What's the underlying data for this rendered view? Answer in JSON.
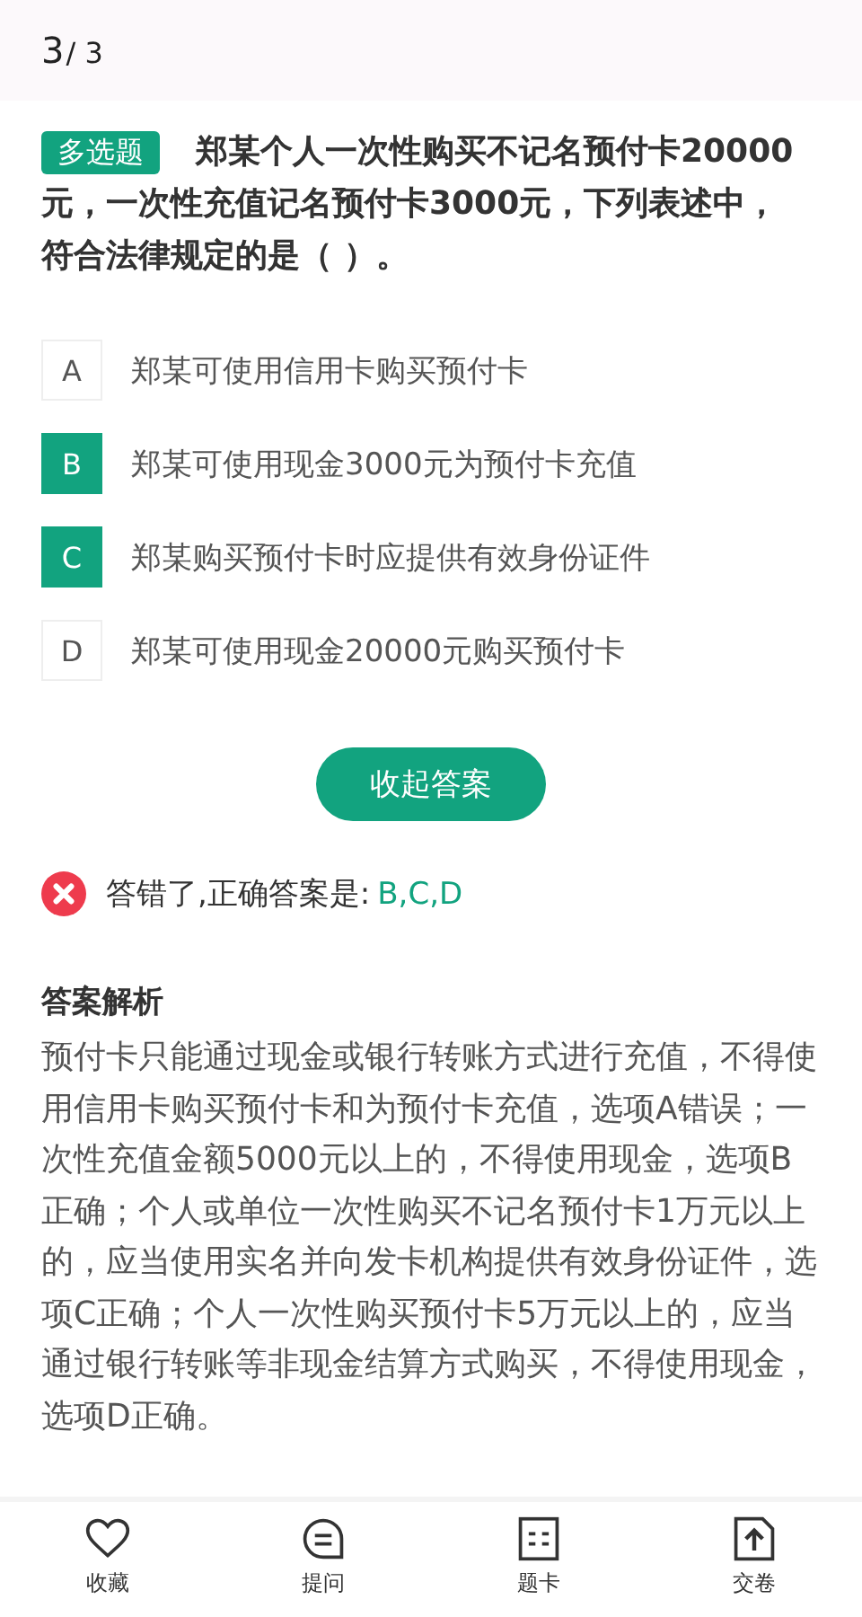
{
  "header": {
    "current": "3",
    "total": "/ 3"
  },
  "question": {
    "type_tag": "多选题",
    "text": "郑某个人一次性购买不记名预付卡20000元，一次性充值记名预付卡3000元，下列表述中，符合法律规定的是（ ）。"
  },
  "options": [
    {
      "letter": "A",
      "text": "郑某可使用信用卡购买预付卡",
      "selected": false
    },
    {
      "letter": "B",
      "text": "郑某可使用现金3000元为预付卡充值",
      "selected": true
    },
    {
      "letter": "C",
      "text": "郑某购买预付卡时应提供有效身份证件",
      "selected": true
    },
    {
      "letter": "D",
      "text": "郑某可使用现金20000元购买预付卡",
      "selected": false
    }
  ],
  "toggle_button": "收起答案",
  "result": {
    "correct": false,
    "message": "答错了,正确答案是:",
    "answer": "B,C,D"
  },
  "explanation": {
    "title": "答案解析",
    "text": "预付卡只能通过现金或银行转账方式进行充值，不得使用信用卡购买预付卡和为预付卡充值，选项A错误；一次性充值金额5000元以上的，不得使用现金，选项B正确；个人或单位一次性购买不记名预付卡1万元以上的，应当使用实名并向发卡机构提供有效身份证件，选项C正确；个人一次性购买预付卡5万元以上的，应当通过银行转账等非现金结算方式购买，不得使用现金，选项D正确。"
  },
  "bottom_nav": [
    {
      "kind": "favorite",
      "label": "收藏"
    },
    {
      "kind": "ask",
      "label": "提问"
    },
    {
      "kind": "card",
      "label": "题卡"
    },
    {
      "kind": "submit",
      "label": "交卷"
    }
  ]
}
